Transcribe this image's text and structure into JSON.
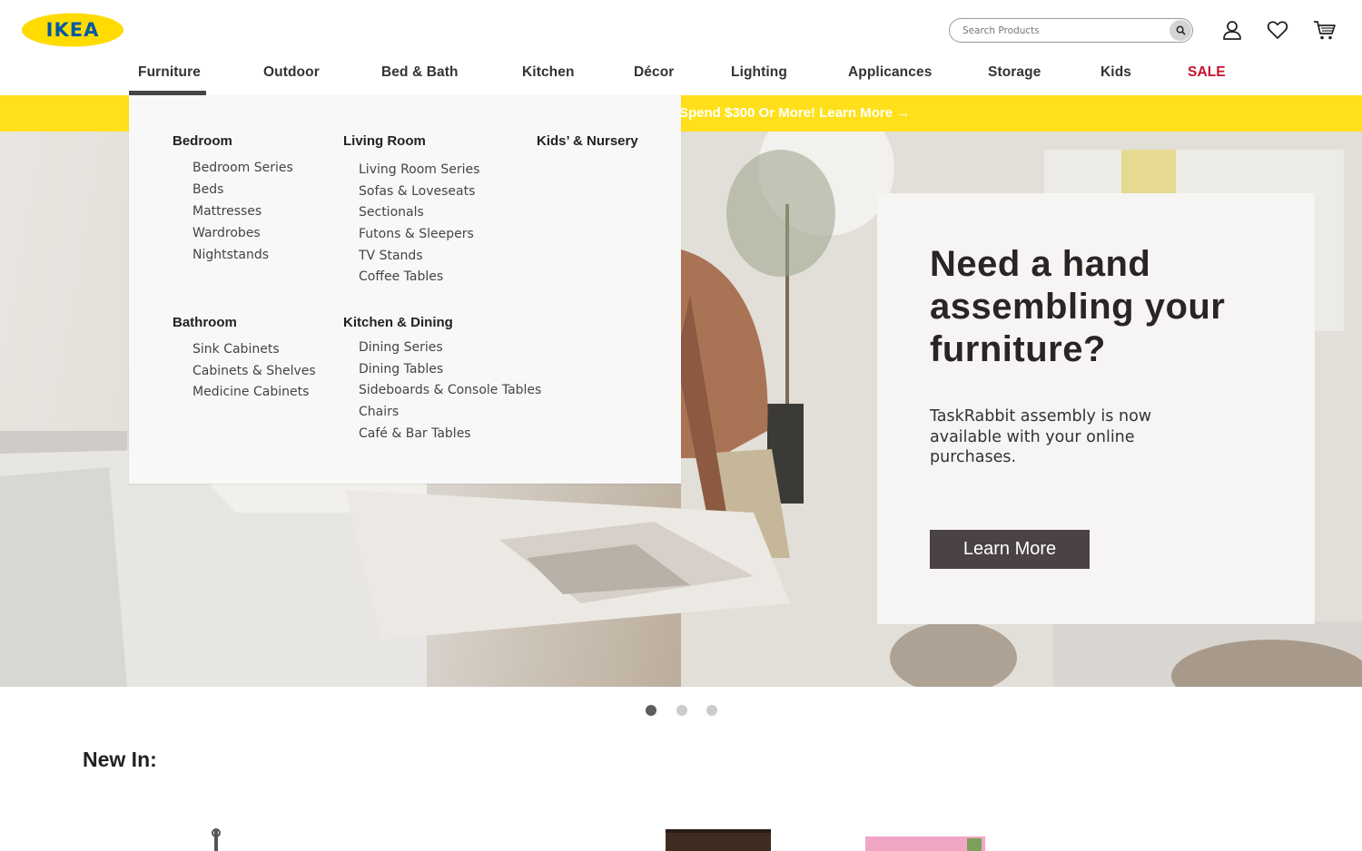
{
  "brand": {
    "logo_text": "IKEA",
    "colors": {
      "blue": "#0058a3",
      "yellow": "#ffdb00",
      "banner": "#ffe01b",
      "sale": "#c8102e"
    }
  },
  "search": {
    "placeholder": "Search Products",
    "value": ""
  },
  "header_icons": [
    "search-icon",
    "account-icon",
    "wishlist-heart-icon",
    "cart-icon"
  ],
  "nav": {
    "active": "Furniture",
    "items": [
      "Furniture",
      "Outdoor",
      "Bed & Bath",
      "Kitchen",
      "Décor",
      "Lighting",
      "Applicances",
      "Storage",
      "Kids",
      "SALE"
    ]
  },
  "banner": {
    "text": "Spend $300 Or More! Learn More →"
  },
  "mega_menu": {
    "bedroom": {
      "title": "Bedroom",
      "links": [
        "Bedroom Series",
        "Beds",
        "Mattresses",
        "Wardrobes",
        "Nightstands"
      ]
    },
    "living_room": {
      "title": "Living Room",
      "links": [
        "Living Room Series",
        "Sofas & Loveseats",
        "Sectionals",
        "Futons & Sleepers",
        "TV Stands",
        "Coffee Tables"
      ]
    },
    "kids": {
      "title": "Kids’ & Nursery",
      "links": []
    },
    "bathroom": {
      "title": "Bathroom",
      "links": [
        "Sink Cabinets",
        "Cabinets & Shelves",
        "Medicine Cabinets"
      ]
    },
    "kitchen_dining": {
      "title": "Kitchen & Dining",
      "links": [
        "Dining Series",
        "Dining Tables",
        "Sideboards & Console Tables",
        "Chairs",
        "Café & Bar Tables"
      ]
    }
  },
  "hero": {
    "heading": "Need a hand assembling your furniture?",
    "body": "TaskRabbit assembly is now available with your online purchases.",
    "button": "Learn More"
  },
  "carousel": {
    "count": 3,
    "active_index": 1
  },
  "new_in": {
    "title": "New In:"
  }
}
